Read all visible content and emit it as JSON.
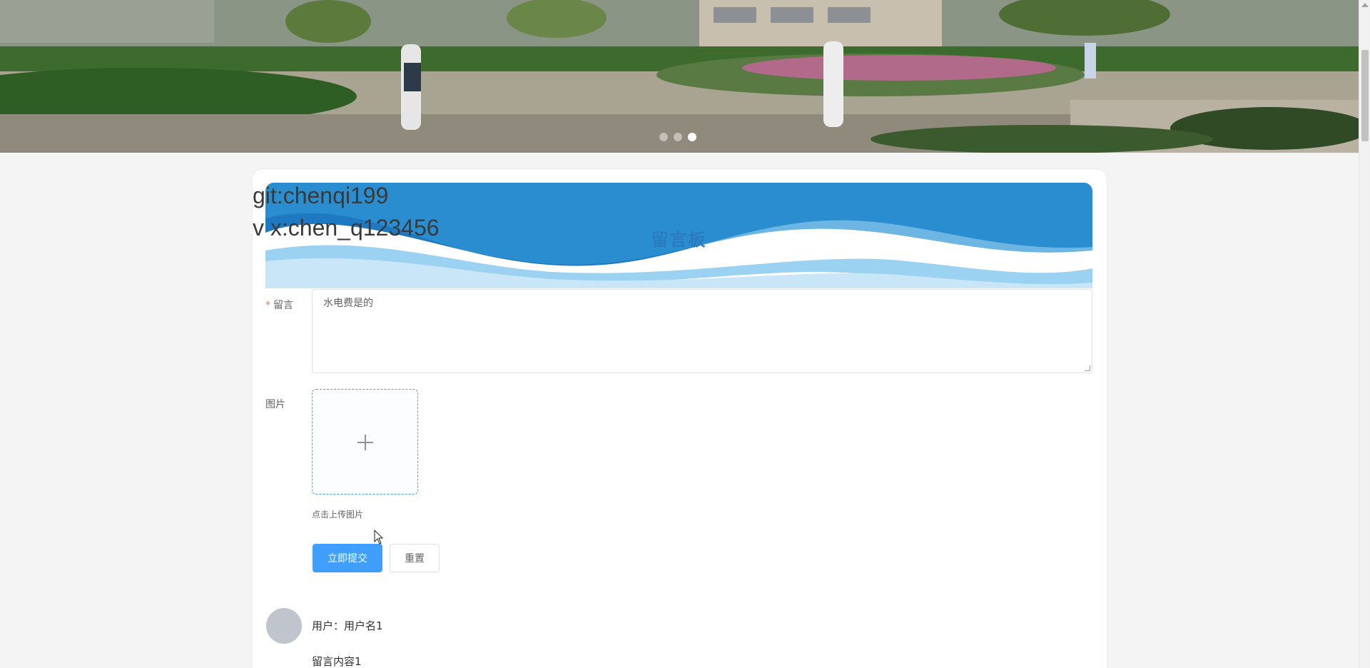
{
  "banner": {
    "carousel_dots": 3,
    "active_dot_index": 2
  },
  "overlay": {
    "line1": "git:chenqi199",
    "line2": "v x:chen_q123456"
  },
  "board": {
    "title": "留言板"
  },
  "form": {
    "message_label": "留言",
    "required_mark": "*",
    "message_value": "水电费是的",
    "image_label": "图片",
    "upload_tip": "点击上传图片",
    "submit_label": "立即提交",
    "reset_label": "重置"
  },
  "comments": [
    {
      "user": "用户：用户名1",
      "content": "留言内容1"
    }
  ],
  "colors": {
    "primary": "#409eff",
    "title_blue": "#2b7bbf",
    "required": "#f56c6c"
  }
}
